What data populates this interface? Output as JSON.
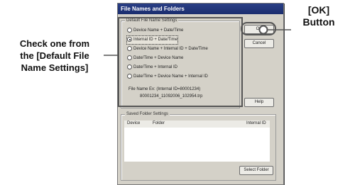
{
  "dialog": {
    "title": "File Names and Folders",
    "default_group_label": "Default File Name Settings",
    "options": [
      "Device Name + Date/Time",
      "Internal ID + Date/Time",
      "Device Name + Internal ID + Date/Time",
      "Date/Time + Device Name",
      "Date/Time + Internal ID",
      "Date/Time + Device Name + Internal ID"
    ],
    "selected_index": 1,
    "file_name_example_line1": "File Name Ex: (Internal ID=80001234)",
    "file_name_example_line2": "80001234_11092006_102954.trp",
    "ok_label": "OK",
    "cancel_label": "Cancel",
    "help_label": "Help",
    "saved_group_label": "Saved Folder Settings",
    "columns": [
      "Device",
      "Folder",
      "Internal ID"
    ],
    "select_folder_label": "Select Folder"
  },
  "callouts": {
    "left_line1": "Check one from",
    "left_line2": "the [Default File",
    "left_line3": "Name Settings]",
    "right_line1": "[OK]",
    "right_line2": "Button"
  }
}
